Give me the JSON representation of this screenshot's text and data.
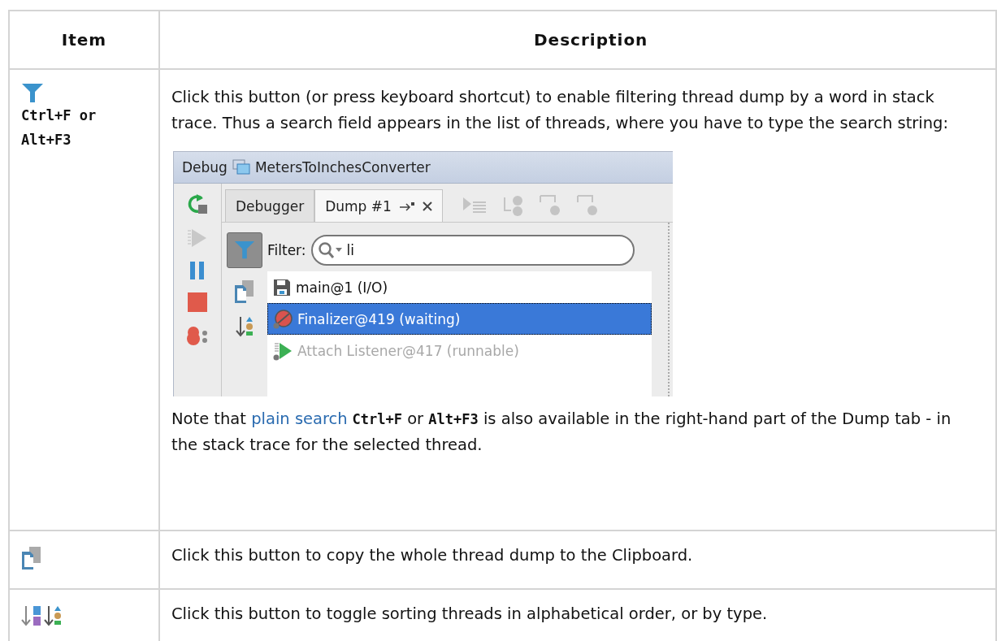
{
  "table": {
    "columns": [
      "Item",
      "Description"
    ],
    "rows": [
      {
        "kind": "filter",
        "shortcut": "Ctrl+F or Alt+F3",
        "description": "Click this button (or press keyboard shortcut) to enable filtering thread dump by a word in stack trace. Thus a search field appears in the list of threads, where you have to type the search string:",
        "screenshot": {
          "title": "Debug",
          "config_name": "MetersToInchesConverter",
          "tabs": [
            {
              "label": "Debugger",
              "selected": false,
              "closable": false
            },
            {
              "label": "Dump #1",
              "selected": true,
              "closable": true
            }
          ],
          "filter_on": true,
          "filter_label": "Filter:",
          "filter_value": "li",
          "threads": [
            {
              "name": "main@1 (I/O)",
              "kind": "io",
              "selected": false,
              "dimmed": false
            },
            {
              "name": "Finalizer@419 (waiting)",
              "kind": "waiting",
              "selected": true,
              "dimmed": false
            },
            {
              "name": "Attach Listener@417 (runnable)",
              "kind": "runnable",
              "selected": false,
              "dimmed": true
            }
          ]
        },
        "note": [
          {
            "kind": "text",
            "text": "Note that "
          },
          {
            "kind": "link",
            "text": "plain search"
          },
          {
            "kind": "code",
            "text": "Ctrl+F"
          },
          {
            "kind": "text",
            "text": " or "
          },
          {
            "kind": "code",
            "text": "Alt+F3"
          },
          {
            "kind": "text",
            "text": " is also available in the right-hand part of the Dump tab - in the stack trace for the selected thread."
          }
        ]
      },
      {
        "kind": "copy",
        "description": "Click this button to copy the whole thread dump to the Clipboard."
      },
      {
        "kind": "sort",
        "description": "Click this button to toggle sorting threads in alphabetical order, or by type."
      }
    ]
  }
}
